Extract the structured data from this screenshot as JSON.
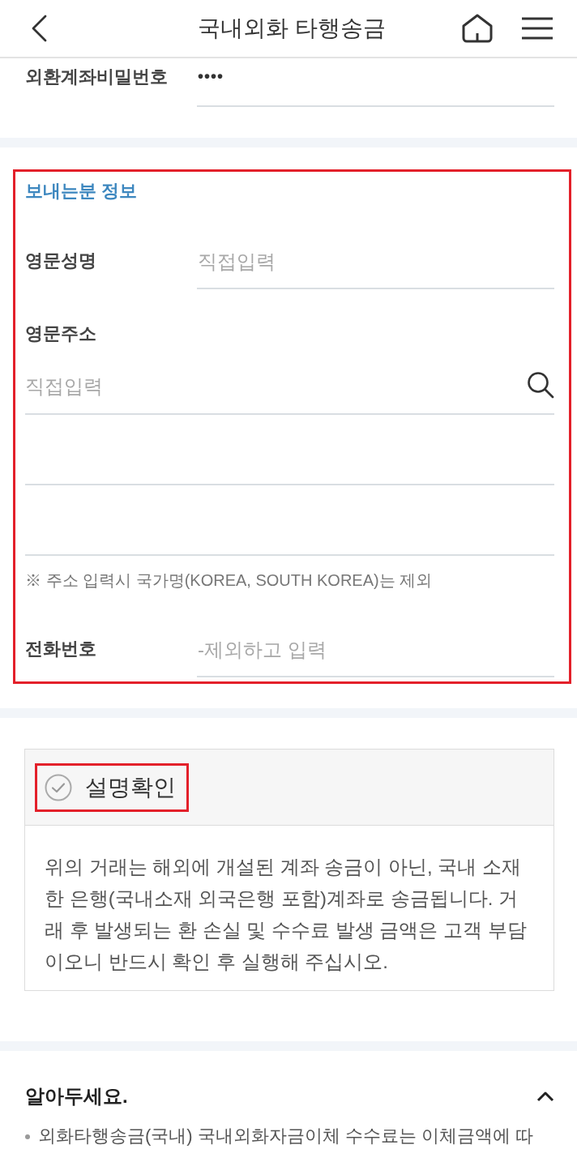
{
  "header": {
    "title": "국내외화 타행송금"
  },
  "password": {
    "label": "외환계좌비밀번호",
    "value": "••••"
  },
  "sender": {
    "title": "보내는분 정보",
    "highlighted": true,
    "name": {
      "label": "영문성명",
      "placeholder": "직접입력"
    },
    "address": {
      "label": "영문주소",
      "fields": [
        {
          "kind": "search",
          "placeholder": "직접입력"
        },
        {
          "kind": "plain"
        },
        {
          "kind": "plain"
        }
      ],
      "note": "※ 주소 입력시 국가명(KOREA, SOUTH KOREA)는 제외"
    },
    "phone": {
      "label": "전화번호",
      "placeholder": "-제외하고 입력"
    }
  },
  "confirm": {
    "label": "설명확인",
    "checked": false,
    "highlighted": true,
    "text": "위의 거래는 해외에 개설된 계좌 송금이 아닌, 국내 소재한 은행(국내소재 외국은행 포함)계좌로 송금됩니다. 거래 후 발생되는 환 손실 및 수수료 발생 금액은 고객 부담이오니 반드시 확인 후 실행해 주십시오."
  },
  "notice": {
    "title": "알아두세요.",
    "expanded": true,
    "items": [
      "외화타행송금(국내) 국내외화자금이체 수수료는 이체금액에 따"
    ]
  }
}
